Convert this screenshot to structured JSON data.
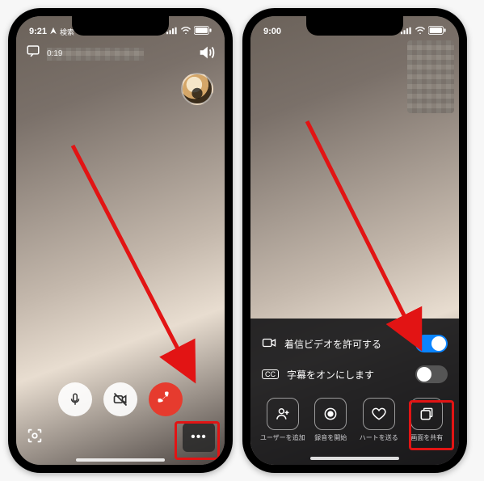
{
  "left": {
    "status": {
      "time": "9:21",
      "loc_icon": "location-icon",
      "search": "検索"
    },
    "call": {
      "duration": "0:19"
    },
    "more_dots": "•••"
  },
  "right": {
    "status": {
      "time": "9:00"
    },
    "toggles": {
      "incoming_video": "着信ビデオを許可する",
      "subtitles": "字幕をオンにします"
    },
    "actions": {
      "add_user": "ユーザーを追加",
      "start_record": "録音を開始",
      "send_heart": "ハートを送る",
      "share_screen": "画面を共有"
    }
  }
}
